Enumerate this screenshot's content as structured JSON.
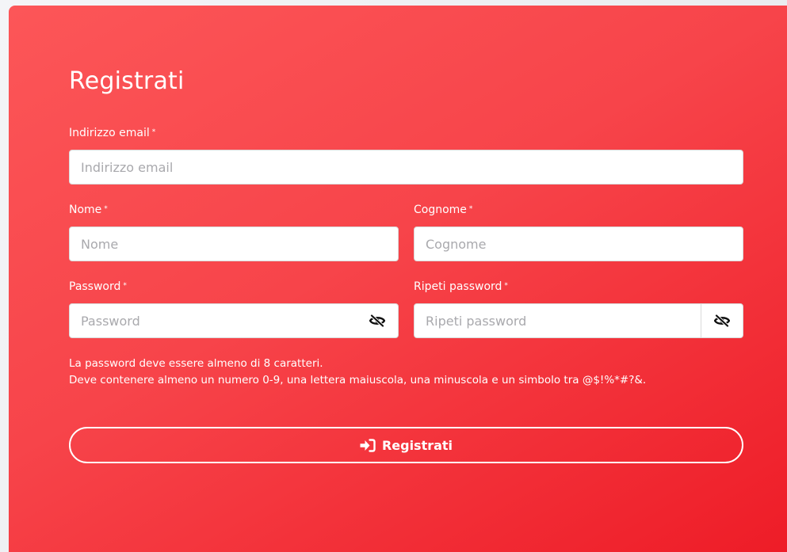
{
  "form": {
    "title": "Registrati",
    "required_mark": "*",
    "email": {
      "label": "Indirizzo email",
      "placeholder": "Indirizzo email",
      "value": ""
    },
    "first_name": {
      "label": "Nome",
      "placeholder": "Nome",
      "value": ""
    },
    "last_name": {
      "label": "Cognome",
      "placeholder": "Cognome",
      "value": ""
    },
    "password": {
      "label": "Password",
      "placeholder": "Password",
      "value": "",
      "toggle_icon": "eye-slash-icon"
    },
    "confirm_password": {
      "label": "Ripeti password",
      "placeholder": "Ripeti password",
      "value": "",
      "toggle_icon": "eye-slash-icon"
    },
    "hint": {
      "line1": "La password deve essere almeno di 8 caratteri.",
      "line2": "Deve contenere almeno un numero 0-9, una lettera maiuscola, una minuscola e un simbolo tra @$!%*#?&."
    },
    "submit": {
      "label": "Registrati",
      "icon": "sign-in-icon"
    }
  },
  "colors": {
    "card_gradient_start": "#fc5658",
    "card_gradient_end": "#ee1c27",
    "text": "#ffffff",
    "placeholder": "#a9a9ad"
  }
}
